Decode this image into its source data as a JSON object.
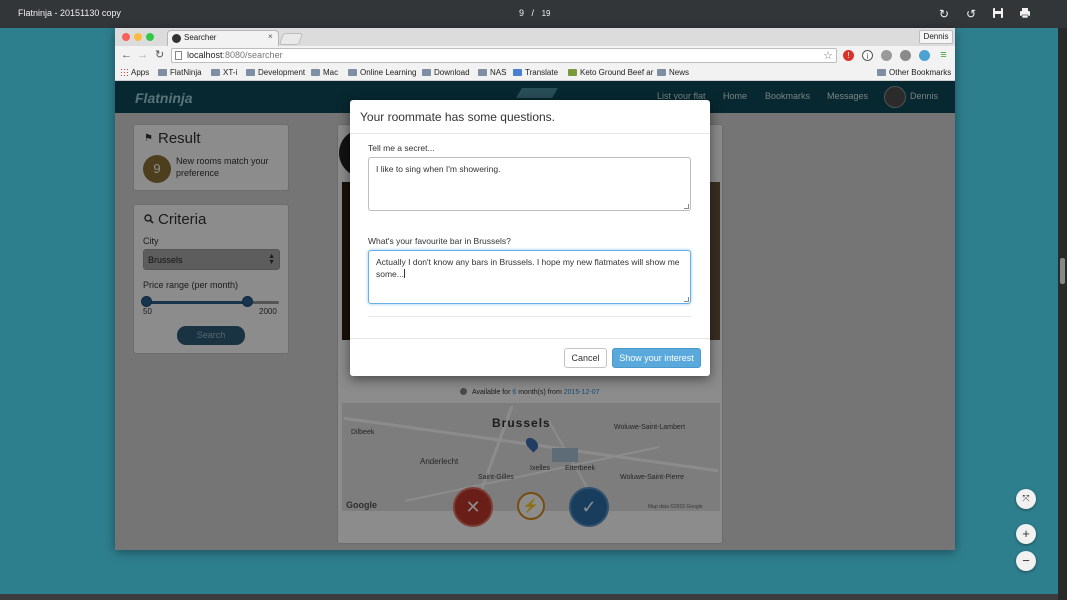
{
  "viewer": {
    "title": "Flatninja - 20151130 copy",
    "page_current": "9",
    "page_separator": "/",
    "page_total": "19",
    "icons": [
      "rotate-icon",
      "rotate-ccw-icon",
      "download-icon",
      "print-icon",
      "fit-page-icon",
      "zoom-in-icon",
      "zoom-out-icon"
    ]
  },
  "browser": {
    "tab_title": "Searcher",
    "tab_close": "×",
    "profile_name": "Dennis",
    "url_host": "localhost",
    "url_rest": ":8080/searcher",
    "bookmarks": [
      "Apps",
      "FlatNinja",
      "XT-i",
      "Development",
      "Mac",
      "Online Learning",
      "Download",
      "NAS",
      "Translate",
      "Keto Ground Beef ar",
      "News",
      "Other Bookmarks"
    ]
  },
  "site": {
    "logo": "Flatninja",
    "nav": [
      "List your flat",
      "Home",
      "Bookmarks",
      "Messages"
    ],
    "user_name": "Dennis"
  },
  "result": {
    "title": "Result",
    "count": "9",
    "text": "New rooms match your preference"
  },
  "criteria": {
    "title": "Criteria",
    "city_label": "City",
    "city_value": "Brussels",
    "price_label": "Price range (per month)",
    "price_min": "50",
    "price_max": "2000",
    "search_label": "Search"
  },
  "listing": {
    "available_prefix": "Available for",
    "months": "6",
    "available_mid": "month(s) from",
    "from_date": "2015-12-07",
    "map_labels": {
      "city": "Brussels",
      "dilbeek": "Dilbeek",
      "anderlecht": "Anderlecht",
      "saint_gilles": "Saint-Gilles",
      "ixelles": "Ixelles",
      "etterbeek": "Etterbeek",
      "woluwe_lambert": "Woluwe-Saint-Lambert",
      "woluwe_pierre": "Woluwe-Saint-Pierre",
      "google": "Google",
      "copyright": "Map data ©2015 Google"
    },
    "actions": {
      "reject": "✕",
      "boost": "⚡",
      "accept": "✓"
    }
  },
  "modal": {
    "title": "Your roommate has some questions.",
    "q1_label": "Tell me a secret...",
    "q1_value": "I like to sing when I'm showering.",
    "q2_label": "What's your favourite bar in Brussels?",
    "q2_value": "Actually I don't know any bars in Brussels. I hope my new flatmates will show me some...",
    "cancel": "Cancel",
    "submit": "Show your interest"
  },
  "colors": {
    "site_nav": "#0d4a58",
    "primary_button": "#5aa9dd",
    "reject": "#c0392b",
    "accept": "#2f6fa8",
    "boost": "#d98a1b"
  }
}
